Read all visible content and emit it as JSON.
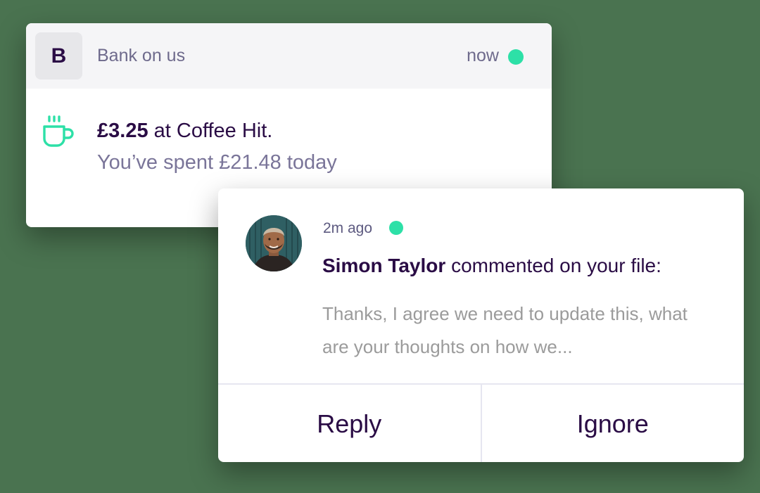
{
  "colors": {
    "background": "#4a7350",
    "brand_text": "#2a0c45",
    "muted_text": "#7a7599",
    "status_dot": "#2de0a7",
    "icon_accent": "#2de0a7"
  },
  "bank_notification": {
    "logo_letter": "B",
    "app_name": "Bank on us",
    "time": "now",
    "icon": "coffee-cup-icon",
    "amount": "£3.25",
    "merchant_text": " at Coffee Hit.",
    "summary": "You’ve spent £21.48 today"
  },
  "comment_notification": {
    "avatar": "user-avatar",
    "time": "2m ago",
    "author": "Simon Taylor",
    "action_text": " commented on your file:",
    "preview": "Thanks, I agree we need to update this, what are your thoughts on how we...",
    "buttons": {
      "reply": "Reply",
      "ignore": "Ignore"
    }
  }
}
